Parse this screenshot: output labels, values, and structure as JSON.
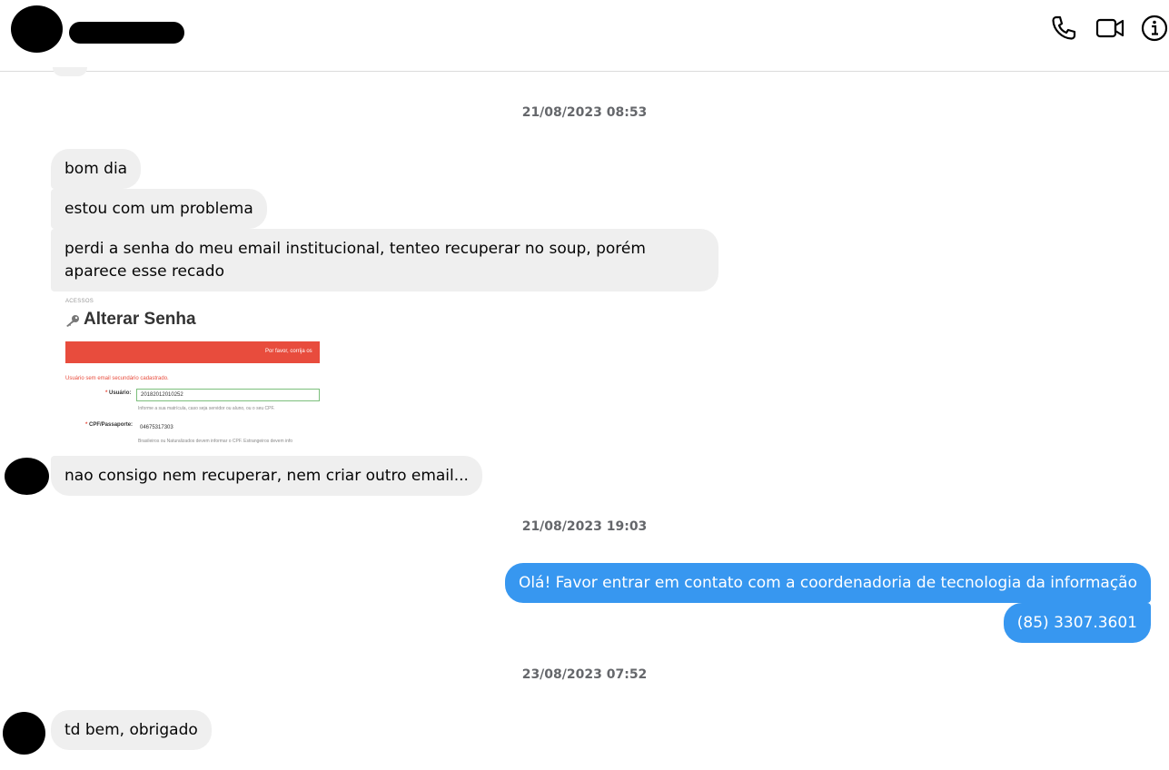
{
  "header": {
    "icons": [
      "phone-icon",
      "video-camera-icon",
      "info-icon"
    ]
  },
  "messages": {
    "ts1": "21/08/2023 08:53",
    "m1": "bom dia",
    "m2": "estou com um problema",
    "m3": "perdi a senha do meu email institucional, tenteo recuperar no soup, porém aparece esse recado",
    "attachment": {
      "caption": "ACESSOS",
      "title": "Alterar Senha",
      "banner": "Por favor, corrija os",
      "error": "Usuário sem email secundário cadastrado.",
      "user_label": "Usuário:",
      "user_value": "20182012010252",
      "user_help": "Informe a sua matrícula, caso seja servidor ou aluno, ou o seu CPF.",
      "cpf_label": "CPF/Passaporte:",
      "cpf_value": "04675317303",
      "cpf_help": "Brasileiros ou Naturalizados devem informar o CPF. Estrangeiros devem info"
    },
    "m4": "nao consigo nem recuperar, nem criar outro email...",
    "ts2": "21/08/2023 19:03",
    "r1": "Olá! Favor entrar em contato com a coordenadoria de tecnologia da informação",
    "r2": "(85) 3307.3601",
    "ts3": "23/08/2023 07:52",
    "m5": "td bem, obrigado"
  },
  "colors": {
    "incoming_bubble": "#efefef",
    "outgoing_bubble": "#3797f0",
    "alert_red": "#e84c3d"
  }
}
